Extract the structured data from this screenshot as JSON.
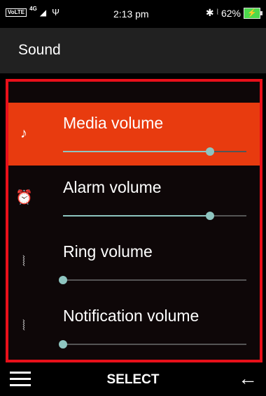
{
  "status": {
    "volte": "VoLTE",
    "network": "4G",
    "time": "2:13 pm",
    "battery": "62%",
    "icons": [
      "signal-icon",
      "usb-icon",
      "bluetooth-icon",
      "vibrate-icon",
      "battery-charging-icon"
    ]
  },
  "header": {
    "title": "Sound"
  },
  "items": [
    {
      "label": "Media volume",
      "icon": "music-note-icon",
      "level": 0.8,
      "selected": true
    },
    {
      "label": "Alarm volume",
      "icon": "alarm-icon",
      "level": 0.8,
      "selected": false
    },
    {
      "label": "Ring volume",
      "icon": "vibrate-icon",
      "level": 0.0,
      "selected": false
    },
    {
      "label": "Notification volume",
      "icon": "vibrate-icon",
      "level": 0.0,
      "selected": false
    }
  ],
  "softkeys": {
    "center": "SELECT"
  },
  "colors": {
    "selected_bg": "#e83b0f",
    "accent": "#8ec5c0",
    "focus_border": "#e8101a"
  }
}
